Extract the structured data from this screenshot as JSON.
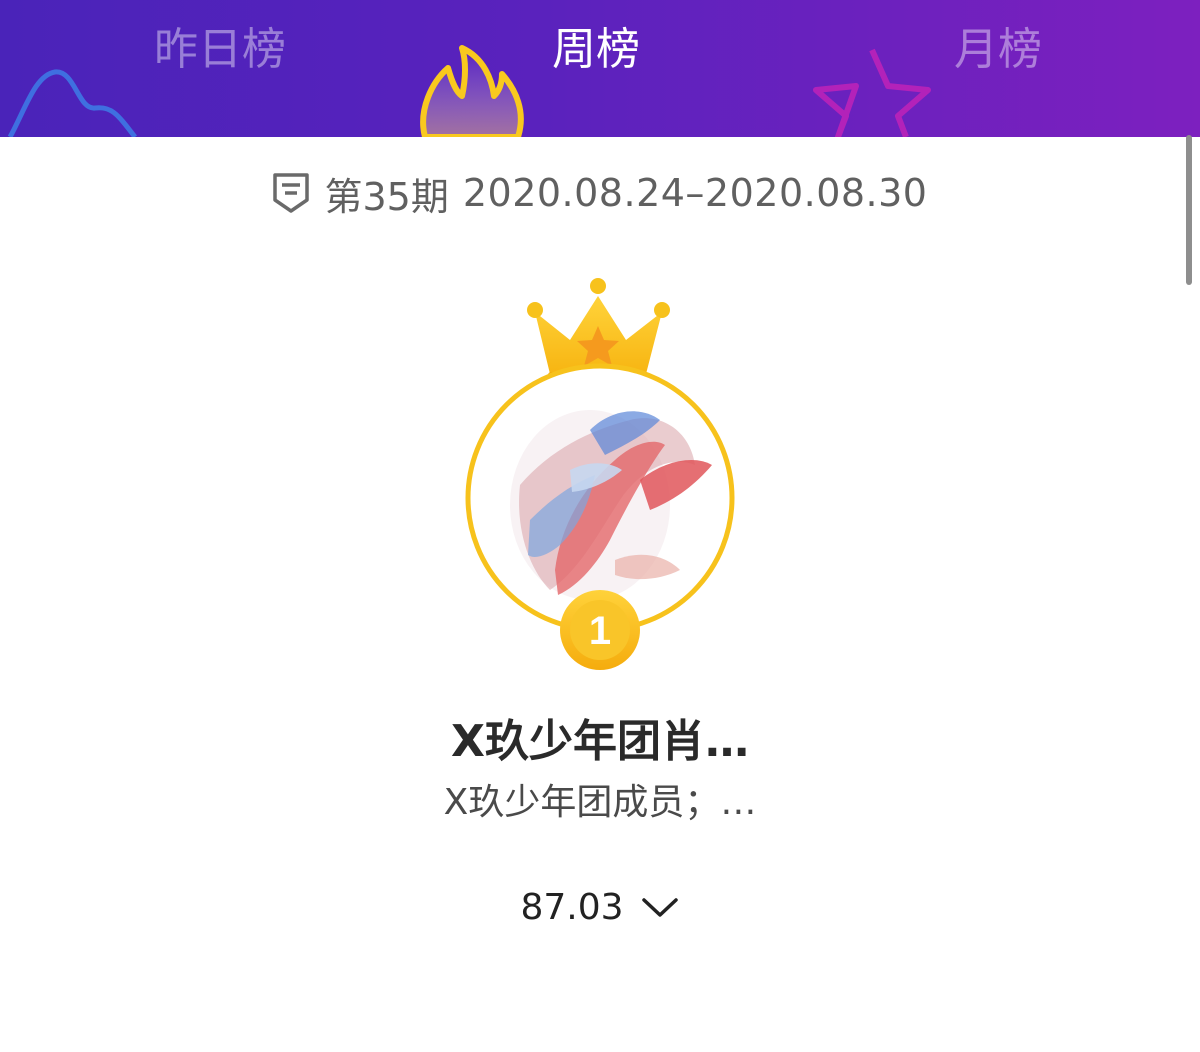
{
  "tabs": [
    {
      "label": "昨日榜",
      "active": false
    },
    {
      "label": "周榜",
      "active": true
    },
    {
      "label": "月榜",
      "active": false
    }
  ],
  "period": {
    "icon": "badge-list-icon",
    "issue": "第35期",
    "date_range": "2020.08.24–2020.08.30"
  },
  "top_entry": {
    "rank": "1",
    "name": "X玖少年团肖…",
    "description": "X玖少年团成员；…",
    "score": "87.03",
    "expand_icon": "chevron-down-icon"
  },
  "colors": {
    "header_start": "#4a23b9",
    "header_end": "#7d20bf",
    "gold": "#f7c21c",
    "inactive_tab": "rgba(255,255,255,0.42)"
  }
}
